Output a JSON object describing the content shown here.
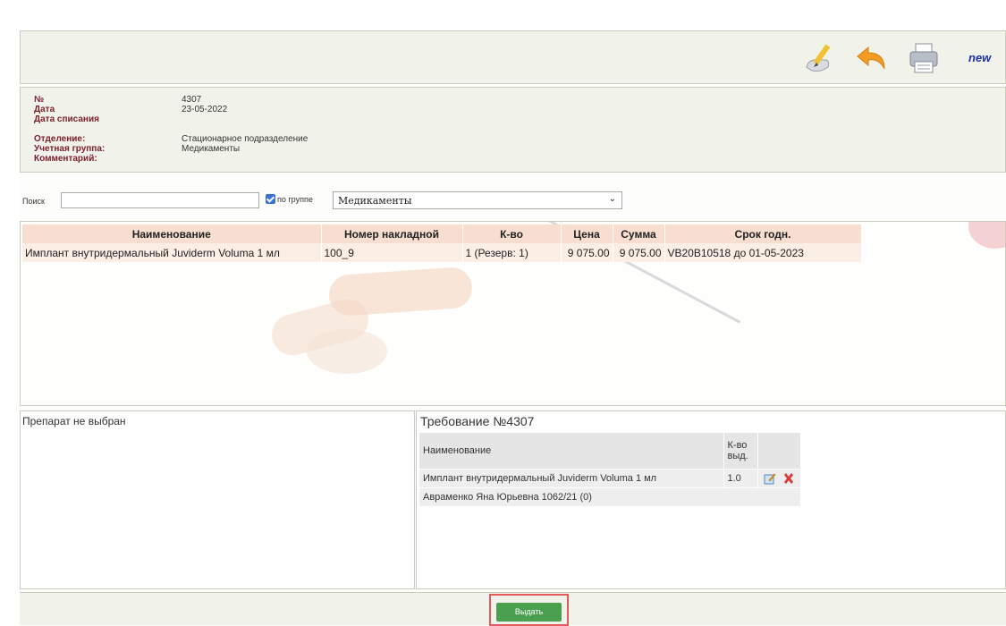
{
  "toolbar": {
    "edit_icon": "edit-pencil-icon",
    "back_icon": "undo-arrow-icon",
    "print_icon": "printer-icon",
    "new_label": "new"
  },
  "info": {
    "rows": [
      {
        "label": "№",
        "value": "4307"
      },
      {
        "label": "Дата",
        "value": "23-05-2022"
      },
      {
        "label": "Дата списания",
        "value": ""
      },
      {
        "label": "Отделение:",
        "value": "Стационарное подразделение"
      },
      {
        "label": "Учетная группа:",
        "value": "Медикаменты"
      },
      {
        "label": "Комментарий:",
        "value": ""
      }
    ]
  },
  "search": {
    "label": "Поиск",
    "value": "",
    "group_checked": true,
    "group_label": "по группе",
    "group_selected": "Медикаменты"
  },
  "meds_table": {
    "headers": [
      "Наименование",
      "Номер накладной",
      "К-во",
      "Цена",
      "Сумма",
      "Срок годн."
    ],
    "rows": [
      [
        "Имплант внутридермальный Juviderm Voluma 1 мл",
        "100_9",
        "1 (Резерв: 1)",
        "9 075.00",
        "9 075.00",
        "VB20B10518 до 01-05-2023"
      ]
    ]
  },
  "left_panel": {
    "text": "Препарат не выбран"
  },
  "requirement": {
    "title": "Требование №4307",
    "headers": [
      "Наименование",
      "К-во выд."
    ],
    "rows": [
      {
        "name": "Имплант внутридермальный Juviderm Voluma 1 мл",
        "qty": "1.0"
      }
    ],
    "patient": "Авраменко Яна Юрьевна 1062/21 (0)"
  },
  "footer": {
    "issue_label": "Выдать"
  },
  "colors": {
    "label_color": "#7a1f2b",
    "header_bg": "#f7ded0",
    "row_bg": "#fbeee4",
    "button_green": "#4aa04f",
    "highlight_red": "#e25a5a",
    "new_link": "#1d2fa8"
  }
}
